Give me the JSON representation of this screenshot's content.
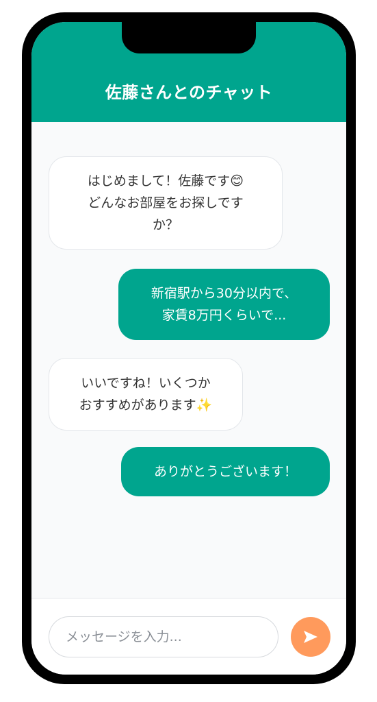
{
  "header": {
    "title": "佐藤さんとのチャット"
  },
  "messages": [
    {
      "sender": "other",
      "text": "はじめまして！佐藤です😊\nどんなお部屋をお探しです\nか？"
    },
    {
      "sender": "me",
      "text": "新宿駅から30分以内で、\n家賃8万円くらいで..."
    },
    {
      "sender": "other",
      "text": "いいですね！いくつか\nおすすめがあります✨"
    },
    {
      "sender": "me",
      "text": "ありがとうございます！"
    }
  ],
  "input": {
    "placeholder": "メッセージを入力...",
    "value": ""
  },
  "send_button": {
    "icon": "send-icon"
  },
  "colors": {
    "accent": "#00a58e",
    "send_button": "#ff9a5c",
    "background": "#f9fafb"
  }
}
